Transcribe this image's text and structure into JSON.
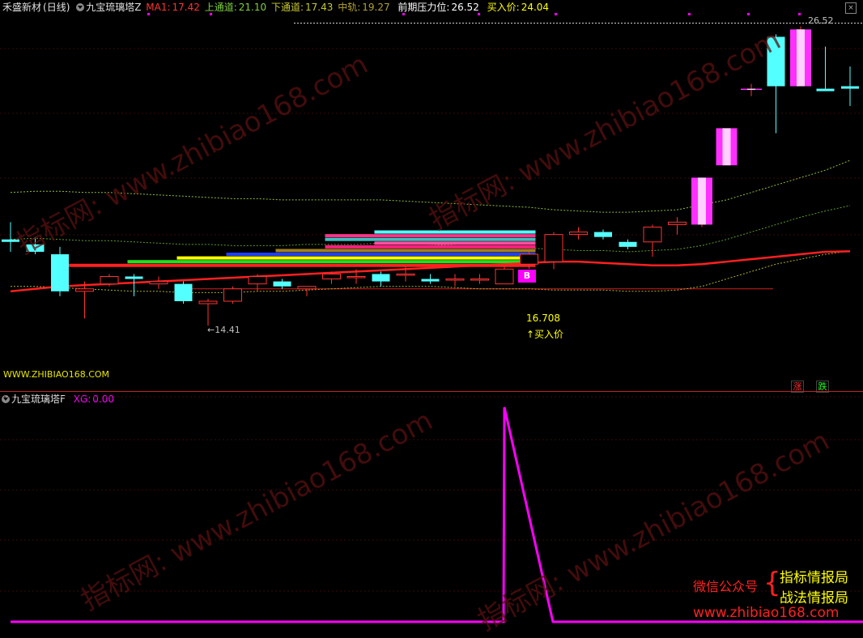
{
  "header_main": {
    "stock_name": "禾盛新材",
    "period": "(日线)",
    "indicator": "九宝琉璃塔Z",
    "ma1_label": "MA1:",
    "ma1_value": "17.42",
    "upper_label": "上通道:",
    "upper_value": "21.10",
    "lower_label": "下通道:",
    "lower_value": "17.43",
    "mid_label": "中轨:",
    "mid_value": "19.27",
    "pressure_label": "前期压力位:",
    "pressure_value": "26.52",
    "buy_label": "买入价:",
    "buy_value": "24.04"
  },
  "header_sub": {
    "indicator": "九宝琉璃塔F",
    "xg_label": "XG:",
    "xg_value": "0.00"
  },
  "annotations": {
    "high_label": "26.52",
    "low_label": "←14.41",
    "buy_price": "16.708",
    "buy_arrow_label": "↑买入价",
    "buy_marker": "B"
  },
  "website": "WWW.ZHIBIAO168.COM",
  "buttons": {
    "up": "涨",
    "down": "跌",
    "corner": "×"
  },
  "watermark": "指标网: www.zhibiao168.com",
  "promo": {
    "wechat": "微信公众号",
    "line1": "指标情报局",
    "line2": "战法情报局",
    "url": "www.zhibiao168.com"
  },
  "colors": {
    "background": "#000000",
    "up_candle": "#ff3232",
    "down_candle": "#54ffff",
    "magenta": "#ff00ff",
    "ma_red": "#ff2020",
    "channel_green": "#8fbf3f",
    "text_gray": "#c0c0c0",
    "text_yellow": "#ffff00"
  },
  "chart_data": {
    "type": "candlestick",
    "candles": [
      {
        "o": 17.9,
        "h": 18.6,
        "l": 17.4,
        "c": 17.8
      },
      {
        "o": 17.7,
        "h": 18.0,
        "l": 17.3,
        "c": 17.4
      },
      {
        "o": 17.3,
        "h": 17.6,
        "l": 15.6,
        "c": 15.8
      },
      {
        "o": 15.8,
        "h": 16.2,
        "l": 14.7,
        "c": 15.9
      },
      {
        "o": 16.1,
        "h": 16.5,
        "l": 16.0,
        "c": 16.4
      },
      {
        "o": 16.4,
        "h": 16.5,
        "l": 15.6,
        "c": 16.3
      },
      {
        "o": 16.1,
        "h": 16.4,
        "l": 15.9,
        "c": 16.2
      },
      {
        "o": 16.1,
        "h": 16.2,
        "l": 15.3,
        "c": 15.4
      },
      {
        "o": 15.3,
        "h": 15.5,
        "l": 14.41,
        "c": 15.4
      },
      {
        "o": 15.4,
        "h": 16.0,
        "l": 15.3,
        "c": 15.9
      },
      {
        "o": 16.1,
        "h": 16.5,
        "l": 15.8,
        "c": 16.4
      },
      {
        "o": 16.2,
        "h": 16.3,
        "l": 15.9,
        "c": 16.0
      },
      {
        "o": 15.9,
        "h": 16.0,
        "l": 15.6,
        "c": 16.0
      },
      {
        "o": 16.3,
        "h": 16.6,
        "l": 16.1,
        "c": 16.5
      },
      {
        "o": 16.4,
        "h": 16.7,
        "l": 16.1,
        "c": 16.4
      },
      {
        "o": 16.5,
        "h": 16.6,
        "l": 16.0,
        "c": 16.2
      },
      {
        "o": 16.5,
        "h": 16.8,
        "l": 16.2,
        "c": 16.5
      },
      {
        "o": 16.3,
        "h": 16.5,
        "l": 16.1,
        "c": 16.2
      },
      {
        "o": 16.3,
        "h": 16.5,
        "l": 16.0,
        "c": 16.3
      },
      {
        "o": 16.3,
        "h": 16.5,
        "l": 16.1,
        "c": 16.3
      },
      {
        "o": 16.1,
        "h": 16.8,
        "l": 16.1,
        "c": 16.7
      },
      {
        "o": 16.9,
        "h": 17.4,
        "l": 16.708,
        "c": 17.3
      },
      {
        "o": 17.0,
        "h": 18.2,
        "l": 16.7,
        "c": 18.1
      },
      {
        "o": 18.1,
        "h": 18.4,
        "l": 17.9,
        "c": 18.2
      },
      {
        "o": 18.2,
        "h": 18.3,
        "l": 17.9,
        "c": 18.0
      },
      {
        "o": 17.8,
        "h": 17.9,
        "l": 17.5,
        "c": 17.6
      },
      {
        "o": 17.8,
        "h": 18.5,
        "l": 17.2,
        "c": 18.4
      },
      {
        "o": 18.5,
        "h": 18.8,
        "l": 18.1,
        "c": 18.6
      },
      {
        "o": 18.5,
        "h": 20.4,
        "l": 18.4,
        "c": 20.4
      },
      {
        "o": 20.9,
        "h": 22.4,
        "l": 20.9,
        "c": 22.4
      },
      {
        "o": 24.0,
        "h": 24.2,
        "l": 23.7,
        "c": 24.0
      },
      {
        "o": 26.1,
        "h": 26.2,
        "l": 22.2,
        "c": 24.1
      },
      {
        "o": 24.1,
        "h": 26.52,
        "l": 24.1,
        "c": 26.4
      },
      {
        "o": 24.0,
        "h": 25.7,
        "l": 24.0,
        "c": 23.9
      },
      {
        "o": 24.1,
        "h": 24.9,
        "l": 23.3,
        "c": 24.0
      }
    ],
    "ma_line": [
      15.8,
      15.9,
      16.0,
      16.05,
      16.1,
      16.15,
      16.2,
      16.25,
      16.3,
      16.35,
      16.4,
      16.45,
      16.5,
      16.55,
      16.6,
      16.65,
      16.7,
      16.75,
      16.8,
      16.85,
      16.9,
      16.95,
      17.0,
      17.0,
      16.95,
      16.9,
      16.85,
      16.85,
      16.9,
      17.0,
      17.1,
      17.2,
      17.3,
      17.4,
      17.42
    ],
    "upper_channel": [
      19.8,
      19.85,
      19.85,
      19.8,
      19.8,
      19.75,
      19.7,
      19.65,
      19.6,
      19.55,
      19.55,
      19.5,
      19.5,
      19.5,
      19.5,
      19.5,
      19.45,
      19.4,
      19.35,
      19.3,
      19.25,
      19.2,
      19.1,
      19.05,
      19.0,
      19.0,
      19.05,
      19.1,
      19.3,
      19.5,
      19.8,
      20.1,
      20.4,
      20.7,
      21.1
    ],
    "lower_channel": [
      16.0,
      16.0,
      15.95,
      15.9,
      15.85,
      15.8,
      15.8,
      15.75,
      15.75,
      15.75,
      15.8,
      15.8,
      15.85,
      15.9,
      15.95,
      16.0,
      16.0,
      16.0,
      15.95,
      15.9,
      15.9,
      15.9,
      15.85,
      15.85,
      15.85,
      15.8,
      15.8,
      15.85,
      16.0,
      16.3,
      16.6,
      16.9,
      17.1,
      17.3,
      17.43
    ],
    "mid_channel": [
      17.9,
      17.95,
      17.9,
      17.85,
      17.85,
      17.8,
      17.75,
      17.7,
      17.7,
      17.65,
      17.65,
      17.65,
      17.7,
      17.7,
      17.7,
      17.75,
      17.75,
      17.7,
      17.65,
      17.6,
      17.55,
      17.55,
      17.5,
      17.45,
      17.45,
      17.4,
      17.45,
      17.5,
      17.65,
      17.9,
      18.2,
      18.5,
      18.8,
      19.05,
      19.27
    ],
    "support_line": 15.9,
    "pressure_line": 26.52,
    "layer_bars": [
      {
        "price": 18.2,
        "from": 15,
        "to": 21,
        "color": "#54ffff"
      },
      {
        "price": 18.05,
        "from": 13,
        "to": 21,
        "color": "#ff3388"
      },
      {
        "price": 17.9,
        "from": 13,
        "to": 21,
        "color": "#40c0c0"
      },
      {
        "price": 17.75,
        "from": 15,
        "to": 21,
        "color": "#ff50a0"
      },
      {
        "price": 17.6,
        "from": 13,
        "to": 21,
        "color": "#ff2080"
      },
      {
        "price": 17.45,
        "from": 11,
        "to": 21,
        "color": "#a08020"
      },
      {
        "price": 17.3,
        "from": 9,
        "to": 21,
        "color": "#2040ff"
      },
      {
        "price": 17.15,
        "from": 7,
        "to": 21,
        "color": "#ffff00"
      },
      {
        "price": 17.0,
        "from": 5,
        "to": 21,
        "color": "#20e020"
      },
      {
        "price": 16.85,
        "from": 2,
        "to": 21,
        "color": "#ff2020"
      }
    ],
    "xg": [
      0,
      0,
      0,
      0,
      0,
      0,
      0,
      0,
      0,
      0,
      0,
      0,
      0,
      0,
      0,
      0,
      0,
      0,
      0,
      0,
      1,
      0,
      0,
      0,
      0,
      0,
      0,
      0,
      0,
      0,
      0,
      0,
      0,
      0,
      0
    ],
    "y_range": [
      13.5,
      27.0
    ],
    "buy_index": 20
  }
}
